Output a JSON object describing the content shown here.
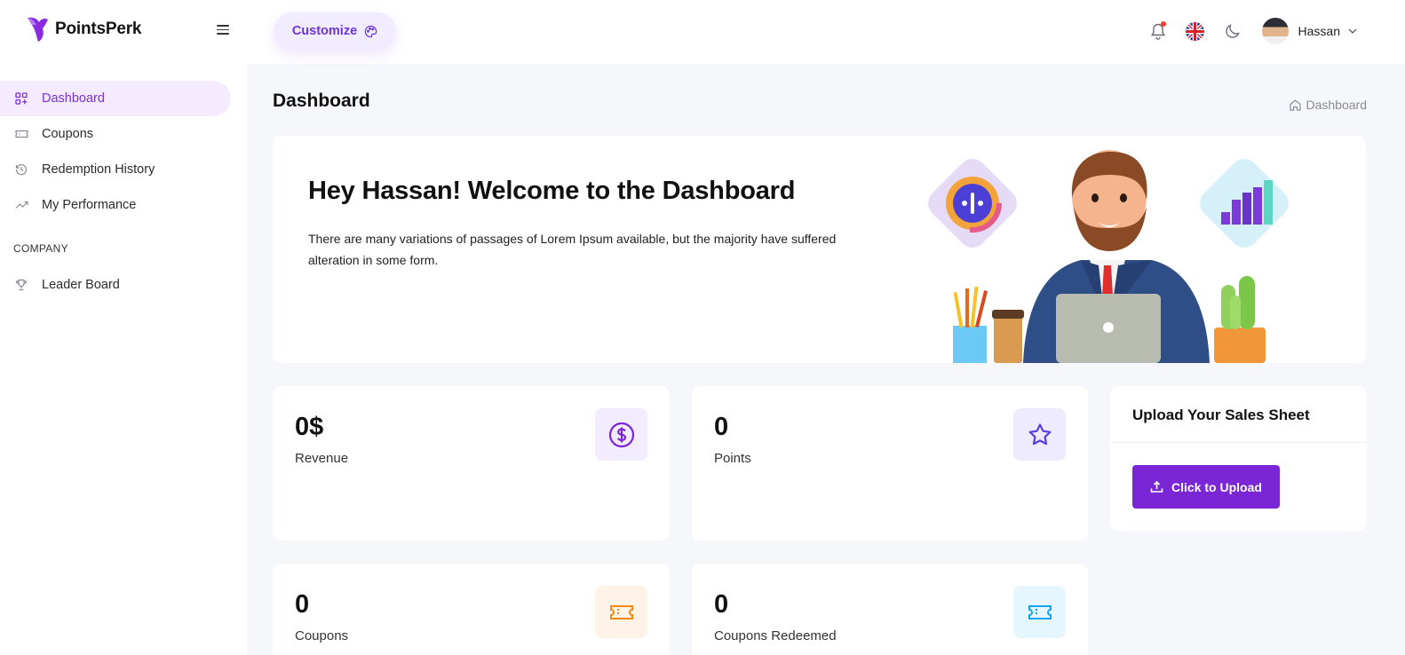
{
  "brand": {
    "name": "PointsPerk"
  },
  "sidebar": {
    "items": [
      {
        "label": "Dashboard",
        "icon": "grid-plus-icon",
        "active": true
      },
      {
        "label": "Coupons",
        "icon": "ticket-icon"
      },
      {
        "label": "Redemption History",
        "icon": "history-icon"
      },
      {
        "label": "My Performance",
        "icon": "trend-up-icon"
      }
    ],
    "section": "COMPANY",
    "company_items": [
      {
        "label": "Leader Board",
        "icon": "trophy-icon"
      }
    ]
  },
  "header": {
    "customize_label": "Customize",
    "user_name": "Hassan",
    "notification_dot_color": "#ff3b30"
  },
  "page": {
    "title": "Dashboard",
    "breadcrumb": "Dashboard"
  },
  "welcome": {
    "heading": "Hey Hassan! Welcome to the Dashboard",
    "text": "There are many variations of passages of Lorem Ipsum available, but the majority have suffered alteration in some form."
  },
  "stats": [
    {
      "value": "0$",
      "label": "Revenue",
      "icon": "dollar-circle-icon",
      "icon_bg": "#f3ecff",
      "icon_color": "#7a26d6"
    },
    {
      "value": "0",
      "label": "Points",
      "icon": "star-icon",
      "icon_bg": "#eeeaff",
      "icon_color": "#5b3de0"
    },
    {
      "value": "0",
      "label": "Coupons",
      "icon": "ticket-icon",
      "icon_bg": "#fff2e6",
      "icon_color": "#f08a12"
    },
    {
      "value": "0",
      "label": "Coupons Redeemed",
      "icon": "ticket-icon",
      "icon_bg": "#e6f6ff",
      "icon_color": "#12a4ef"
    }
  ],
  "upload": {
    "title": "Upload Your Sales Sheet",
    "button_label": "Click to Upload",
    "button_color": "#7a26d6"
  },
  "colors": {
    "accent": "#7c2fd8",
    "active_bg": "#f5ebff",
    "page_bg": "#f6f7fb"
  }
}
